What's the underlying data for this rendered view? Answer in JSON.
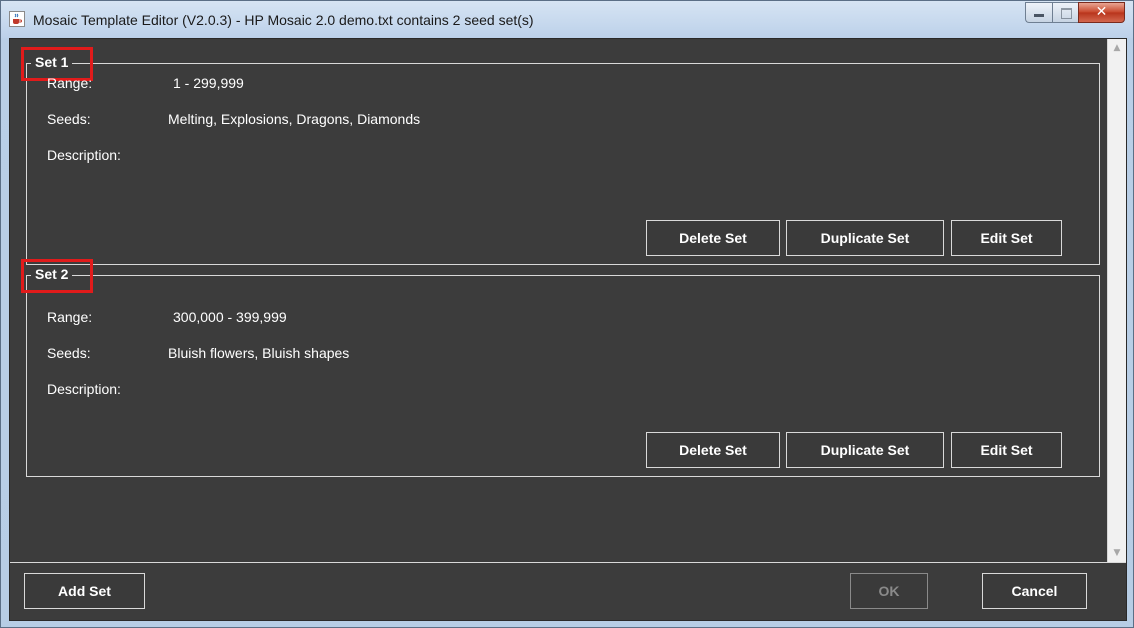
{
  "window": {
    "title": "Mosaic Template Editor (V2.0.3) - HP Mosaic 2.0 demo.txt contains 2 seed set(s)",
    "app_icon": "java-cup-icon",
    "controls": {
      "minimize": "minimize-icon",
      "maximize": "maximize-icon",
      "close": "✕"
    }
  },
  "sets": [
    {
      "title": "Set 1",
      "range_label": "Range:",
      "range_value": "1 - 299,999",
      "seeds_label": "Seeds:",
      "seeds_value": "Melting, Explosions, Dragons, Diamonds",
      "description_label": "Description:",
      "delete_label": "Delete Set",
      "duplicate_label": "Duplicate Set",
      "edit_label": "Edit Set"
    },
    {
      "title": "Set 2",
      "range_label": "Range:",
      "range_value": "300,000 - 399,999",
      "seeds_label": "Seeds:",
      "seeds_value": "Bluish flowers, Bluish shapes",
      "description_label": "Description:",
      "delete_label": "Delete Set",
      "duplicate_label": "Duplicate Set",
      "edit_label": "Edit Set"
    }
  ],
  "footer": {
    "add_set_label": "Add Set",
    "ok_label": "OK",
    "cancel_label": "Cancel"
  },
  "colors": {
    "panel_background": "#3c3c3c",
    "highlight": "#e11b1b",
    "text": "#ffffff"
  }
}
